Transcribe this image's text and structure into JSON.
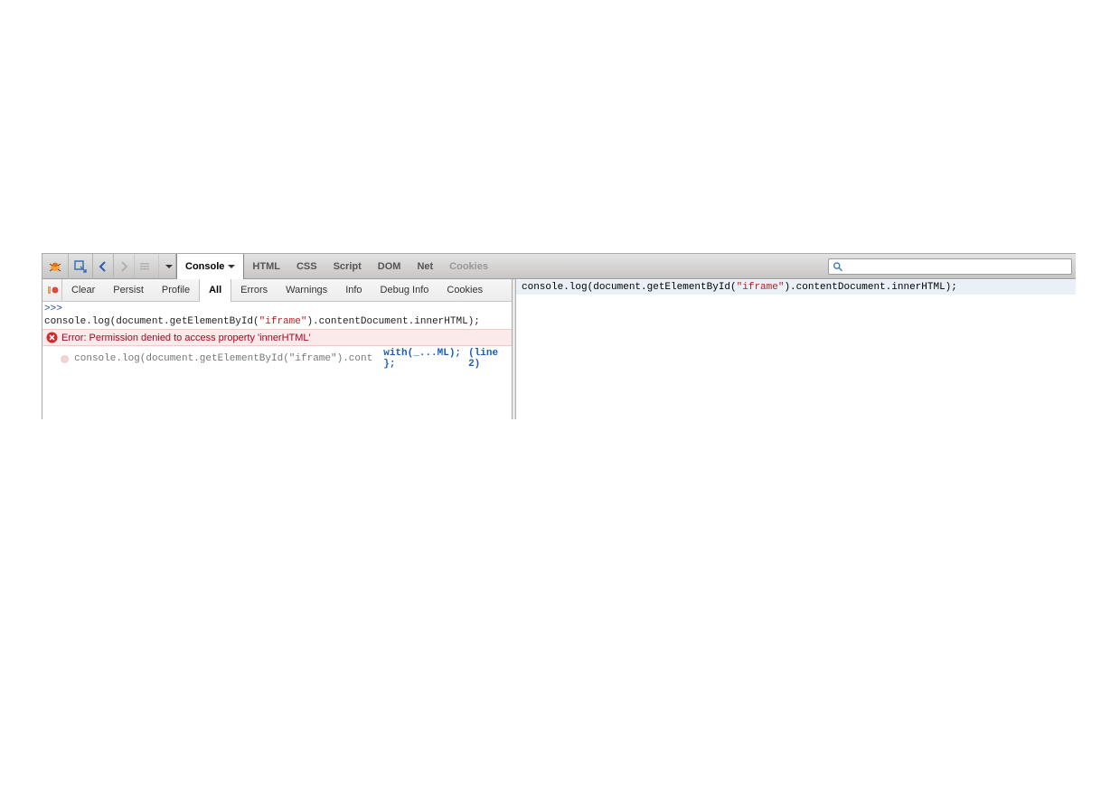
{
  "tabs": {
    "console": "Console",
    "html": "HTML",
    "css": "CSS",
    "script": "Script",
    "dom": "DOM",
    "net": "Net",
    "cookies": "Cookies"
  },
  "subtabs": {
    "clear": "Clear",
    "persist": "Persist",
    "profile": "Profile",
    "all": "All",
    "errors": "Errors",
    "warnings": "Warnings",
    "info": "Info",
    "debuginfo": "Debug Info",
    "cookies": "Cookies"
  },
  "search": {
    "placeholder": ""
  },
  "console": {
    "prompt": ">>>",
    "input_pre": "console.log(document.getElementById(",
    "input_str": "\"iframe\"",
    "input_post": ").contentDocument.innerHTML);",
    "error_text": "Error: Permission denied to access property 'innerHTML'",
    "trace_code": "console.log(document.getElementById(\"iframe\").cont",
    "trace_link": "with(_...ML); };",
    "trace_loc": "(line 2)"
  },
  "right": {
    "pre": "console.log(document.getElementById(",
    "str": "\"iframe\"",
    "post": ").contentDocument.innerHTML);"
  }
}
